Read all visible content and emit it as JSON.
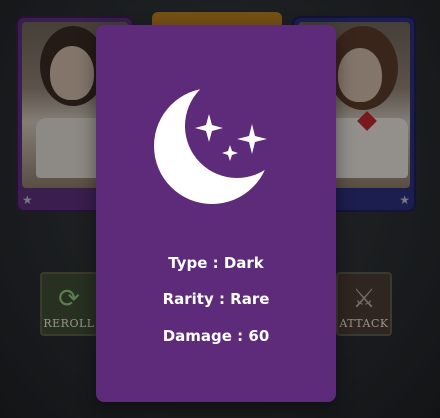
{
  "background_cards": {
    "left_card": {
      "frame_color": "#5a2f79"
    },
    "middle_card": {
      "frame_color": "#b47c1f"
    },
    "right_card": {
      "frame_color": "#2b2f7a"
    }
  },
  "actions": {
    "reroll": {
      "label": "REROLL",
      "icon": "reroll-icon"
    },
    "attack": {
      "label": "ATTACK",
      "icon": "crossed-swords-icon"
    }
  },
  "card_popup": {
    "icon": "moon-stars-icon",
    "background_color": "#5e2a7a",
    "type_text": "Type : Dark",
    "rarity_text": "Rarity : Rare",
    "damage_text": "Damage : 60"
  }
}
